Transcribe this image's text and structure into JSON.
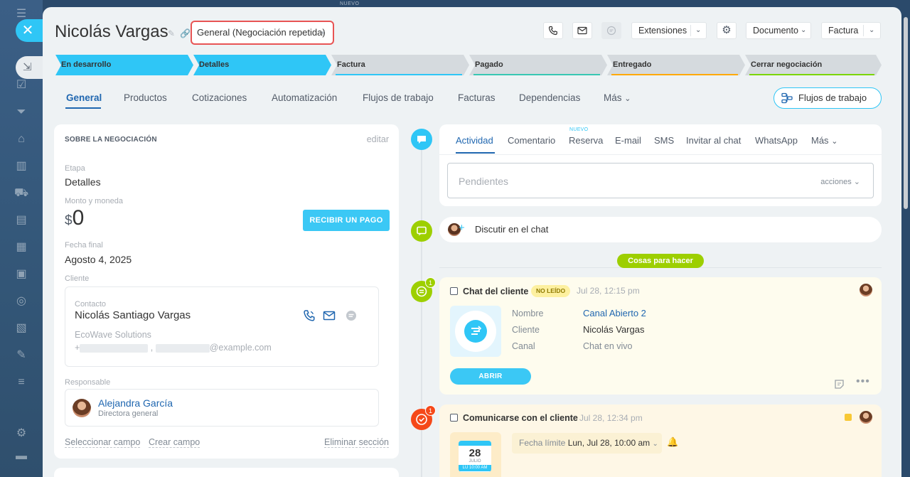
{
  "background": {
    "top_badge": "NUEVO",
    "close_glyph": "✕"
  },
  "header": {
    "title": "Nicolás Vargas",
    "category": "General (Negociación repetida)",
    "extensions_label": "Extensiones",
    "document_label": "Documento",
    "invoice_label": "Factura"
  },
  "stages": [
    {
      "label": "En desarrollo",
      "color": "#2fc6f6",
      "active": true
    },
    {
      "label": "Detalles",
      "color": "#2fc6f6",
      "active": true
    },
    {
      "label": "Factura",
      "color": "#2fc6f6",
      "active": false
    },
    {
      "label": "Pagado",
      "color": "#39c7b3",
      "active": false
    },
    {
      "label": "Entregado",
      "color": "#ffa900",
      "active": false
    },
    {
      "label": "Cerrar negociación",
      "color": "#7bd500",
      "active": false
    }
  ],
  "tabs": [
    "General",
    "Productos",
    "Cotizaciones",
    "Automatización",
    "Flujos de trabajo",
    "Facturas",
    "Dependencias",
    "Más"
  ],
  "workflow_button": "Flujos de trabajo",
  "deal": {
    "section_title": "SOBRE LA NEGOCIACIÓN",
    "edit": "editar",
    "stage_label": "Etapa",
    "stage_value": "Detalles",
    "amount_label": "Monto y moneda",
    "currency": "$",
    "amount": "0",
    "pay_button": "RECIBIR UN PAGO",
    "end_date_label": "Fecha final",
    "end_date": "Agosto 4, 2025",
    "client_label": "Cliente",
    "contact_label": "Contacto",
    "contact_name": "Nicolás Santiago Vargas",
    "company": "EcoWave Solutions",
    "phone_prefix": "+",
    "email_suffix": "@example.com",
    "responsible_label": "Responsable",
    "responsible_name": "Alejandra García",
    "responsible_position": "Directora general",
    "select_field": "Seleccionar campo",
    "create_field": "Crear campo",
    "delete_section": "Eliminar sección"
  },
  "activity": {
    "tabs": [
      "Actividad",
      "Comentario",
      "Reserva",
      "E-mail",
      "SMS",
      "Invitar al chat",
      "WhatsApp",
      "Más"
    ],
    "new_badge": "NUEVO",
    "pending_placeholder": "Pendientes",
    "actions": "acciones"
  },
  "discuss": "Discutir en el chat",
  "todo_label": "Cosas para hacer",
  "client_chat": {
    "badge": "1",
    "title": "Chat del cliente",
    "status": "NO LEÍDO",
    "time": "Jul 28, 12:15 pm",
    "rows": [
      {
        "key": "Nombre",
        "value": "Canal Abierto 2"
      },
      {
        "key": "Cliente",
        "value": "Nicolás Vargas"
      },
      {
        "key": "Canal",
        "value": "Chat en vivo"
      }
    ],
    "open_button": "ABRIR"
  },
  "contact_task": {
    "badge": "1",
    "title": "Comunicarse con el cliente",
    "time": "Jul 28, 12:34 pm",
    "cal_day": "28",
    "cal_month": "JULIO",
    "cal_time": "LU 10:00 AM",
    "deadline_label": "Fecha límite",
    "deadline_value": "Lun, Jul 28, 10:00 am"
  },
  "colors": {
    "accent": "#2fc6f6",
    "link": "#2067b0",
    "green": "#9dcf00",
    "red": "#f54819",
    "highlight": "#e85454"
  }
}
